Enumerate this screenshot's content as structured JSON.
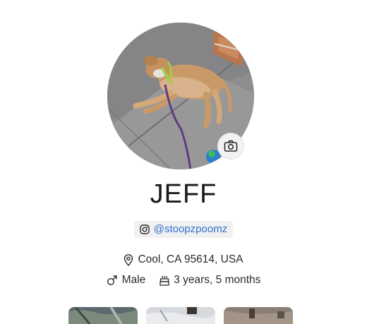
{
  "profile": {
    "name": "JEFF",
    "avatar_icon": "dog-photo",
    "camera_icon": "camera-icon",
    "social": {
      "icon": "instagram-icon",
      "handle": "@stoopzpoomz",
      "color": "#2f6fd1"
    },
    "location": {
      "icon": "map-pin-icon",
      "text": "Cool, CA 95614, USA"
    },
    "sex": {
      "icon": "male-symbol-icon",
      "text": "Male"
    },
    "age": {
      "icon": "birthday-cake-icon",
      "text": "3 years, 5 months"
    }
  },
  "gallery": {
    "thumbnails": [
      "photo-thumbnail",
      "photo-thumbnail",
      "photo-thumbnail"
    ]
  }
}
